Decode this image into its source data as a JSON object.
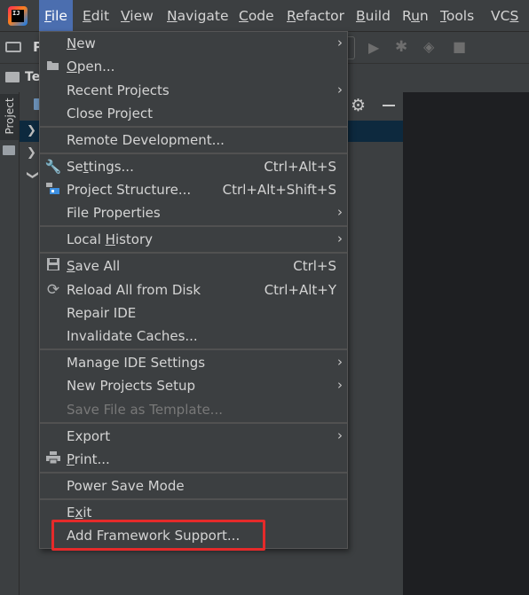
{
  "menubar": {
    "items": [
      {
        "label": "File",
        "mnemonic": "F"
      },
      {
        "label": "Edit",
        "mnemonic": "E"
      },
      {
        "label": "View",
        "mnemonic": "V"
      },
      {
        "label": "Navigate",
        "mnemonic": "N"
      },
      {
        "label": "Code",
        "mnemonic": "C"
      },
      {
        "label": "Refactor",
        "mnemonic": "R"
      },
      {
        "label": "Build",
        "mnemonic": "B"
      },
      {
        "label": "Run",
        "mnemonic": "u"
      },
      {
        "label": "Tools",
        "mnemonic": "T"
      },
      {
        "label": "VCS",
        "mnemonic": "S"
      }
    ],
    "logo_text": "IJ",
    "active_color": "#4b6eaf"
  },
  "toolbar": {
    "title_fragment": "P",
    "breadcrumb_fragment": "Te",
    "run_icon": "run-icon",
    "debug_icon": "debug-icon",
    "coverage_icon": "coverage-icon",
    "stop_icon": "stop-icon"
  },
  "tool_window": {
    "stripe_label": "Project"
  },
  "file_menu": {
    "items": [
      {
        "label": "New",
        "mnemonic": "N",
        "submenu": true
      },
      {
        "label": "Open...",
        "mnemonic": "O",
        "icon": "open-folder-icon"
      },
      {
        "label": "Recent Projects",
        "mnemonic": "",
        "submenu": true
      },
      {
        "label": "Close Project",
        "mnemonic": ""
      },
      {
        "label": "Remote Development...",
        "mnemonic": ""
      },
      {
        "label": "Settings...",
        "mnemonic": "t",
        "shortcut": "Ctrl+Alt+S",
        "icon": "wrench-icon"
      },
      {
        "label": "Project Structure...",
        "mnemonic": "",
        "shortcut": "Ctrl+Alt+Shift+S",
        "icon": "project-structure-icon"
      },
      {
        "label": "File Properties",
        "mnemonic": "",
        "submenu": true
      },
      {
        "label": "Local History",
        "mnemonic": "H",
        "submenu": true
      },
      {
        "label": "Save All",
        "mnemonic": "S",
        "shortcut": "Ctrl+S",
        "icon": "save-icon"
      },
      {
        "label": "Reload All from Disk",
        "mnemonic": "",
        "shortcut": "Ctrl+Alt+Y",
        "icon": "reload-icon"
      },
      {
        "label": "Repair IDE",
        "mnemonic": ""
      },
      {
        "label": "Invalidate Caches...",
        "mnemonic": ""
      },
      {
        "label": "Manage IDE Settings",
        "mnemonic": "",
        "submenu": true
      },
      {
        "label": "New Projects Setup",
        "mnemonic": "",
        "submenu": true
      },
      {
        "label": "Save File as Template...",
        "mnemonic": "",
        "disabled": true
      },
      {
        "label": "Export",
        "mnemonic": "",
        "submenu": true
      },
      {
        "label": "Print...",
        "mnemonic": "P",
        "icon": "print-icon"
      },
      {
        "label": "Power Save Mode",
        "mnemonic": ""
      },
      {
        "label": "Exit",
        "mnemonic": "x"
      },
      {
        "label": "Add Framework Support...",
        "mnemonic": ""
      }
    ],
    "highlight_color": "#e52a2a"
  }
}
